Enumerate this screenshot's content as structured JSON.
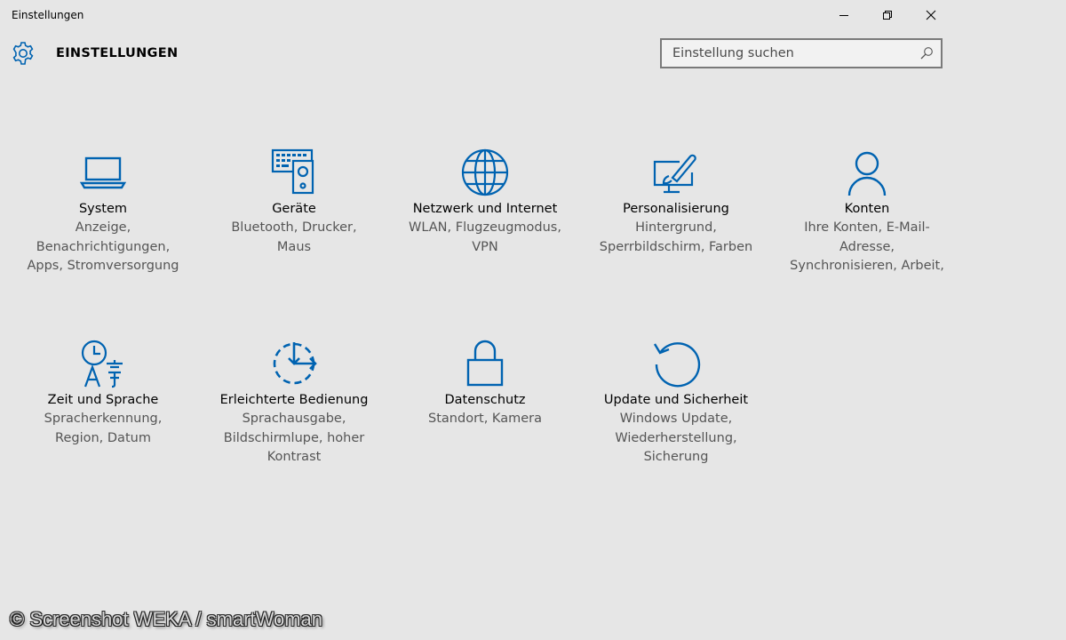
{
  "window": {
    "title": "Einstellungen",
    "controls": {
      "minimize_icon": "minimize-icon",
      "maximize_icon": "restore-icon",
      "close_icon": "close-icon"
    }
  },
  "header": {
    "icon": "gear-icon",
    "title": "EINSTELLUNGEN",
    "search": {
      "value": "",
      "placeholder": "Einstellung suchen",
      "icon": "search-icon"
    }
  },
  "accent_color": "#0063b1",
  "categories": [
    {
      "icon": "laptop-icon",
      "title": "System",
      "subtitle": "Anzeige,\nBenachrichtigungen,\nApps, Stromversorgung"
    },
    {
      "icon": "keyboard-speaker-icon",
      "title": "Geräte",
      "subtitle": "Bluetooth, Drucker,\nMaus"
    },
    {
      "icon": "globe-icon",
      "title": "Netzwerk und Internet",
      "subtitle": "WLAN, Flugzeugmodus,\nVPN"
    },
    {
      "icon": "paint-monitor-icon",
      "title": "Personalisierung",
      "subtitle": "Hintergrund,\nSperrbildschirm, Farben"
    },
    {
      "icon": "person-icon",
      "title": "Konten",
      "subtitle": "Ihre Konten, E-Mail-\nAdresse,\nSynchronisieren, Arbeit,"
    },
    {
      "icon": "time-language-icon",
      "title": "Zeit und Sprache",
      "subtitle": "Spracherkennung,\nRegion, Datum"
    },
    {
      "icon": "ease-of-access-icon",
      "title": "Erleichterte Bedienung",
      "subtitle": "Sprachausgabe,\nBildschirmlupe, hoher\nKontrast"
    },
    {
      "icon": "lock-icon",
      "title": "Datenschutz",
      "subtitle": "Standort, Kamera"
    },
    {
      "icon": "update-icon",
      "title": "Update und Sicherheit",
      "subtitle": "Windows Update,\nWiederherstellung,\nSicherung"
    }
  ],
  "watermark": "© Screenshot WEKA / smartWoman"
}
